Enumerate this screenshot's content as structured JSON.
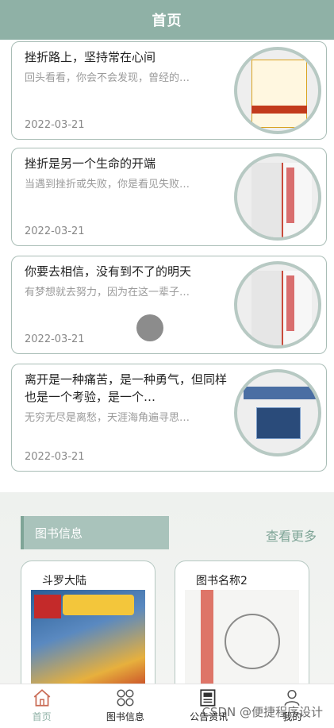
{
  "header": {
    "title": "首页"
  },
  "articles": [
    {
      "title": "挫折路上，坚持常在心间",
      "summary": "回头看看，你会不会发现，曾经的…",
      "date": "2022-03-21"
    },
    {
      "title": "挫折是另一个生命的开端",
      "summary": "当遇到挫折或失败，你是看见失败…",
      "date": "2022-03-21"
    },
    {
      "title": "你要去相信，没有到不了的明天",
      "summary": "有梦想就去努力，因为在这一辈子…",
      "date": "2022-03-21"
    },
    {
      "title": "离开是一种痛苦，是一种勇气，但同样也是一个考验，是一个…",
      "summary": "无穷无尽是离愁，天涯海角遍寻思…",
      "date": "2022-03-21"
    }
  ],
  "book_section": {
    "title": "图书信息",
    "more": "查看更多",
    "books": [
      {
        "name": "斗罗大陆"
      },
      {
        "name": "图书名称2"
      }
    ]
  },
  "tabbar": {
    "items": [
      {
        "label": "首页",
        "icon": "home-icon",
        "active": true
      },
      {
        "label": "图书信息",
        "icon": "grid-icon",
        "active": false
      },
      {
        "label": "公告资讯",
        "icon": "news-icon",
        "active": false
      },
      {
        "label": "我的",
        "icon": "user-icon",
        "active": false
      }
    ]
  },
  "watermark": "CSDN @便捷程序设计",
  "colors": {
    "accent": "#8fb1a6",
    "border": "#a9bdb6"
  }
}
